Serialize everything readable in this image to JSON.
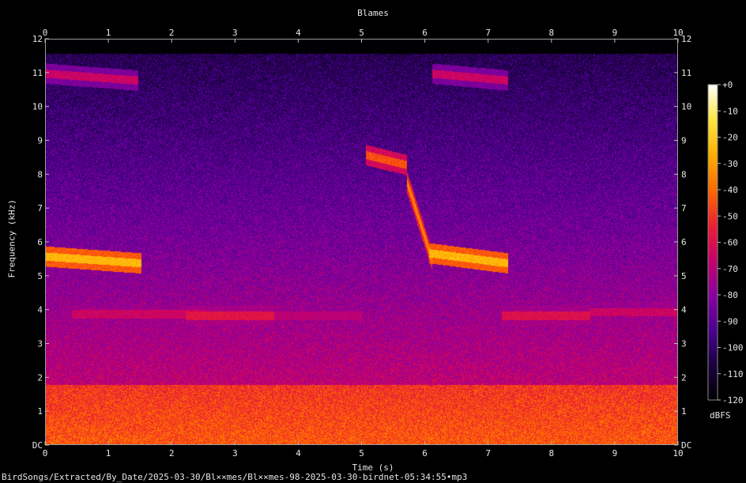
{
  "chart_data": {
    "type": "heatmap",
    "title": "Blames",
    "xlabel": "Time (s)",
    "ylabel": "Frequency (kHz)",
    "x_ticks": [
      "0",
      "1",
      "2",
      "3",
      "4",
      "5",
      "6",
      "7",
      "8",
      "9",
      "10"
    ],
    "y_ticks": [
      "DC",
      "1",
      "2",
      "3",
      "4",
      "5",
      "6",
      "7",
      "8",
      "9",
      "10",
      "11",
      "12"
    ],
    "xlim": [
      0,
      10
    ],
    "ylim": [
      0,
      12
    ],
    "colorbar": {
      "label": "dBFS",
      "ticks": [
        "+0",
        "-10",
        "-20",
        "-30",
        "-40",
        "-50",
        "-60",
        "-70",
        "-80",
        "-90",
        "-100",
        "-110",
        "-120"
      ],
      "range": [
        -120,
        0
      ],
      "colors": [
        "#000000",
        "#1a0040",
        "#4a0090",
        "#8a00a0",
        "#c8006a",
        "#ee2030",
        "#ff6a00",
        "#ffb000",
        "#ffe640",
        "#ffffff"
      ]
    },
    "features": [
      {
        "name": "song-trill",
        "t0": 0.0,
        "t1": 1.5,
        "f0": 5.6,
        "f1": 5.4,
        "db": -25
      },
      {
        "name": "song-trill",
        "t0": 6.05,
        "t1": 7.3,
        "f0": 5.7,
        "f1": 5.4,
        "db": -25
      },
      {
        "name": "upper-trill",
        "t0": 0.0,
        "t1": 1.45,
        "f0": 11.0,
        "f1": 10.8,
        "db": -65
      },
      {
        "name": "upper-trill",
        "t0": 6.1,
        "t1": 7.3,
        "f0": 11.0,
        "f1": 10.8,
        "db": -65
      },
      {
        "name": "sweep",
        "t0": 5.05,
        "t1": 5.7,
        "f0": 8.6,
        "f1": 8.3,
        "db": -45
      },
      {
        "name": "sweep",
        "t0": 5.7,
        "t1": 6.1,
        "f0": 7.8,
        "f1": 5.5,
        "db": -35
      },
      {
        "name": "tone",
        "t0": 0.4,
        "t1": 2.5,
        "f0": 3.9,
        "f1": 3.9,
        "db": -65
      },
      {
        "name": "tone",
        "t0": 2.2,
        "t1": 3.6,
        "f0": 3.85,
        "f1": 3.85,
        "db": -58
      },
      {
        "name": "tone",
        "t0": 3.6,
        "t1": 5.0,
        "f0": 3.85,
        "f1": 3.85,
        "db": -70
      },
      {
        "name": "tone",
        "t0": 7.2,
        "t1": 8.6,
        "f0": 3.85,
        "f1": 3.85,
        "db": -60
      },
      {
        "name": "tone",
        "t0": 8.6,
        "t1": 10.0,
        "f0": 3.95,
        "f1": 3.95,
        "db": -65
      }
    ]
  },
  "file_path": "BirdSongs/Extracted/By_Date/2025-03-30/Bl××mes/Bl××mes-98-2025-03-30-birdnet-05:34:55•mp3"
}
